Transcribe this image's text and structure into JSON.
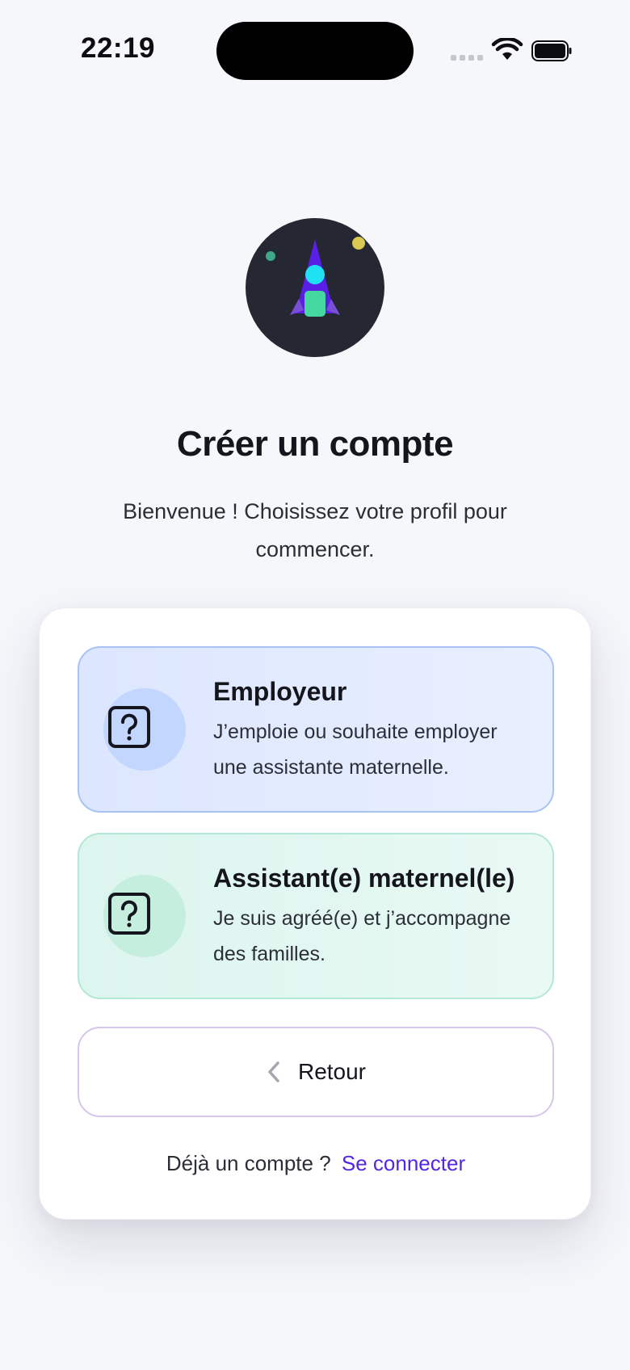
{
  "status_bar": {
    "time": "22:19"
  },
  "icons": {
    "logo": "rocket-logo-icon",
    "employer": "question-square-icon",
    "assistant": "question-square-icon",
    "back": "chevron-left-icon"
  },
  "header": {
    "title": "Créer un compte",
    "subtitle": "Bienvenue ! Choisissez votre profil pour commencer."
  },
  "options": [
    {
      "title": "Employeur",
      "description": "J’emploie ou souhaite employer une assistante maternelle.",
      "color": "#dce6fe"
    },
    {
      "title": "Assistant(e) maternel(le)",
      "description": "Je suis agréé(e) et j’accompagne des familles.",
      "color": "#dcf5ee"
    }
  ],
  "back_button": {
    "label": "Retour"
  },
  "signin": {
    "prompt": "Déjà un compte ?",
    "link": "Se connecter",
    "link_color": "#5425e8"
  }
}
